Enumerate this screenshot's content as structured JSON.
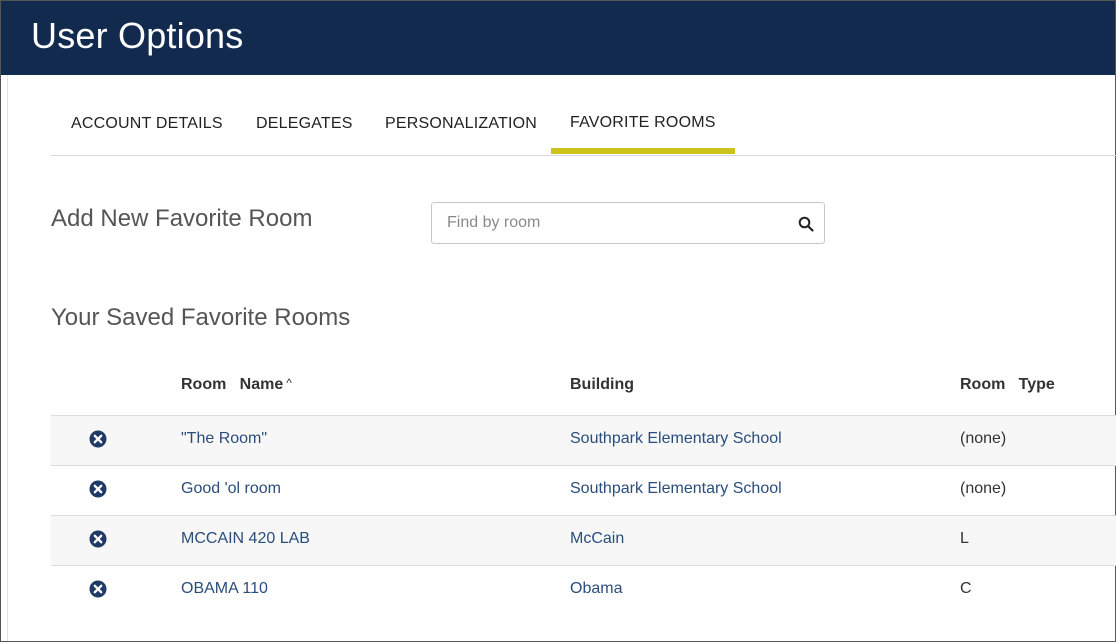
{
  "header": {
    "title": "User Options"
  },
  "tabs": [
    {
      "label": "ACCOUNT DETAILS"
    },
    {
      "label": "DELEGATES"
    },
    {
      "label": "PERSONALIZATION"
    },
    {
      "label": "FAVORITE ROOMS"
    }
  ],
  "active_tab": "FAVORITE ROOMS",
  "add_section": {
    "title": "Add New Favorite Room",
    "search_placeholder": "Find by room",
    "search_value": ""
  },
  "saved_section": {
    "title": "Your Saved Favorite Rooms",
    "columns": {
      "room_name": "Room   Name",
      "building": "Building",
      "room_type": "Room   Type"
    },
    "sort_indicator": "^",
    "rows": [
      {
        "room": "\"The Room\"",
        "building": "Southpark Elementary School",
        "type": "(none)"
      },
      {
        "room": "Good 'ol room",
        "building": "Southpark Elementary School",
        "type": "(none)"
      },
      {
        "room": "MCCAIN 420 LAB",
        "building": "McCain",
        "type": "L"
      },
      {
        "room": "OBAMA 110",
        "building": "Obama",
        "type": "C"
      }
    ]
  },
  "colors": {
    "header_bg": "#132a4f",
    "tab_active_underline": "#cdc21a",
    "link": "#2a4d7c",
    "remove_icon": "#1f3a66"
  },
  "icons": {
    "search": "search-icon",
    "remove": "remove-circle-x-icon",
    "sort": "caret-up-icon"
  }
}
